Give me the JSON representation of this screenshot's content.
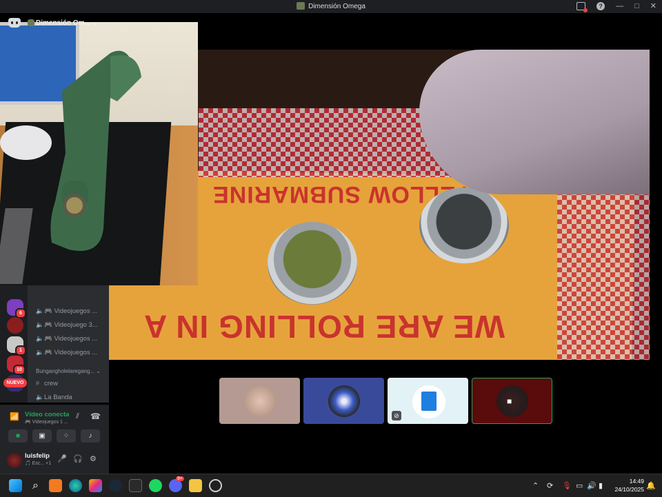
{
  "window": {
    "title": "Dimensión Omega",
    "controls": [
      "—",
      "□",
      "✕"
    ]
  },
  "discord": {
    "server_name": "Dimensión Om...",
    "guilds": [
      {
        "badge": "6",
        "color": "#7b3fbf"
      },
      {
        "badge": "",
        "color": "#8a1e1e"
      },
      {
        "badge": "1",
        "color": "#d0d0d0"
      },
      {
        "badge": "10",
        "color": "#c42a35"
      },
      {
        "badge": "",
        "color": "#3b2a6e"
      }
    ],
    "new_label": "NUEVO",
    "voice_channels": [
      {
        "name": "🎮 Videojuegos ..."
      },
      {
        "name": "🎮 Videojuego 3..."
      },
      {
        "name": "🎮 Videojuegos ..."
      },
      {
        "name": "🎮 Videojuegos ..."
      }
    ],
    "category": "Bungangholelaregang...",
    "text_channels": [
      {
        "icon": "#",
        "name": "crew"
      },
      {
        "icon": "🔊",
        "name": "La Banda"
      }
    ],
    "voice_panel": {
      "status": "Vídeo conectado",
      "subtitle": "🎮 Videojuegos 1 ..."
    },
    "user": {
      "name": "luisfelip",
      "status": "🎵 Esc... +1"
    }
  },
  "overlay_texts": {
    "top": "YELLOW SUBMARINE",
    "bottom": "WE ARE ROLLING IN A"
  },
  "taskbar": {
    "time": "14:49",
    "date": "24/10/2025",
    "discord_badge": "9+"
  }
}
